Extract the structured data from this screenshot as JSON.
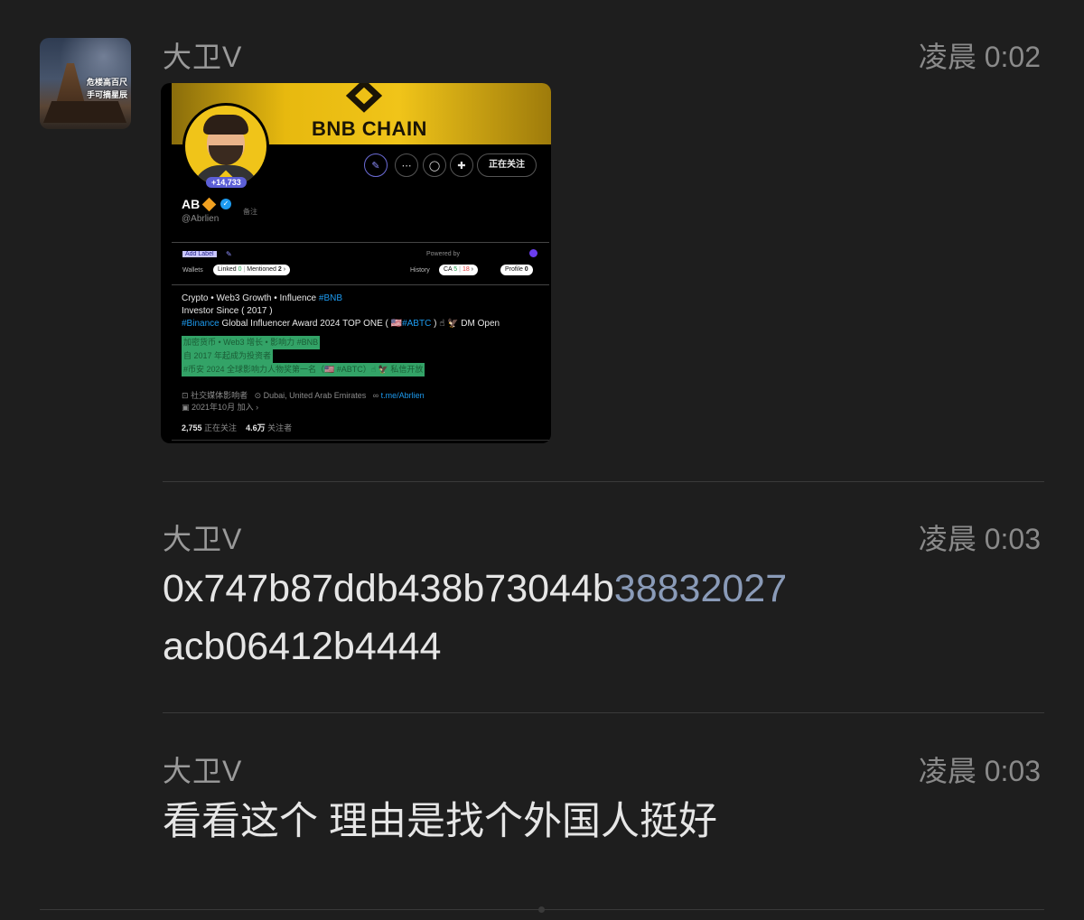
{
  "chat": {
    "messages": [
      {
        "sender": "大卫V",
        "time": "凌晨 0:02",
        "type": "image"
      },
      {
        "sender": "大卫V",
        "time": "凌晨 0:03",
        "line1_plain": "0x747b87ddb438b73044b",
        "line1_highlight": "38832027",
        "line2": "acb06412b4444"
      },
      {
        "sender": "大卫V",
        "time": "凌晨 0:03",
        "text": "看看这个 理由是找个外国人挺好"
      }
    ],
    "avatar_text_1": "危楼高百尺",
    "avatar_text_2": "手可摘星辰"
  },
  "profile": {
    "banner_title": "BNB CHAIN",
    "follow_count_badge": "+14,733",
    "following_button": "正在关注",
    "name": "AB",
    "note": "备注",
    "handle": "@Abrlien",
    "ext": {
      "add_label": "Add Label",
      "powered_by": "Powered by",
      "wallets_label": "Wallets",
      "linked_label": "Linked",
      "linked_count": "0",
      "mentioned_label": "Mentioned",
      "mentioned_count": "2",
      "history_label": "History",
      "ca_label": "CA",
      "ca_green": "5",
      "ca_red": "18",
      "profile_label": "Profile",
      "profile_count": "0"
    },
    "bio": {
      "line1_text": "Crypto • Web3 Growth • Influence ",
      "line1_tag": "#BNB",
      "line2": "Investor Since ( 2017 )",
      "line3_tag": "#Binance",
      "line3_text": " Global Influencer Award 2024 TOP ONE ( 🇺🇸",
      "line3_tag2": "#ABTC",
      "line3_end": " ) ☝ 🦅 DM  Open"
    },
    "translation": {
      "l1": "加密货币 • Web3 增长 • 影响力 #BNB",
      "l2": "自 2017 年起成为投资者",
      "l3": "#币安 2024 全球影响力人物奖第一名（🇺🇸 #ABTC）☝ 🦅 私信开放"
    },
    "meta": {
      "category": "社交媒体影响者",
      "location": "Dubai, United Arab Emirates",
      "link": "t.me/Abrlien",
      "joined": "2021年10月 加入"
    },
    "stats": {
      "following_num": "2,755",
      "following_label": "正在关注",
      "followers_num": "4.6万",
      "followers_label": "关注者"
    }
  }
}
